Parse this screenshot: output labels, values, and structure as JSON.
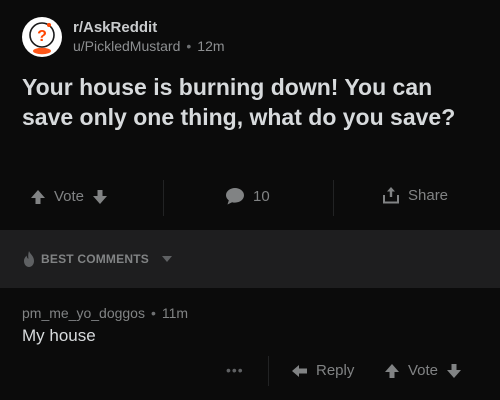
{
  "post": {
    "subreddit": "r/AskReddit",
    "author": "u/PickledMustard",
    "separator": "•",
    "age": "12m",
    "title": "Your house is burning down! You can save only one thing, what do you save?",
    "vote_label": "Vote",
    "comment_count": "10",
    "share_label": "Share"
  },
  "comments_section": {
    "sort_label": "BEST COMMENTS"
  },
  "comment": {
    "author": "pm_me_yo_doggos",
    "separator": "•",
    "age": "11m",
    "body": "My house",
    "more_label": "•••",
    "reply_label": "Reply",
    "vote_label": "Vote"
  },
  "colors": {
    "background": "#0b0b0b",
    "section_bar": "#1e1e1f",
    "text_primary": "#d7dadc",
    "text_secondary": "#818384",
    "avatar_ring": "#ff4500"
  },
  "icons": {
    "avatar": "askreddit-snoo-icon",
    "upvote": "arrow-up-icon",
    "downvote": "arrow-down-icon",
    "comments": "speech-bubble-icon",
    "share": "share-icon",
    "sort": "flame-icon",
    "sort_dropdown": "chevron-down-icon",
    "reply": "reply-arrow-icon"
  }
}
